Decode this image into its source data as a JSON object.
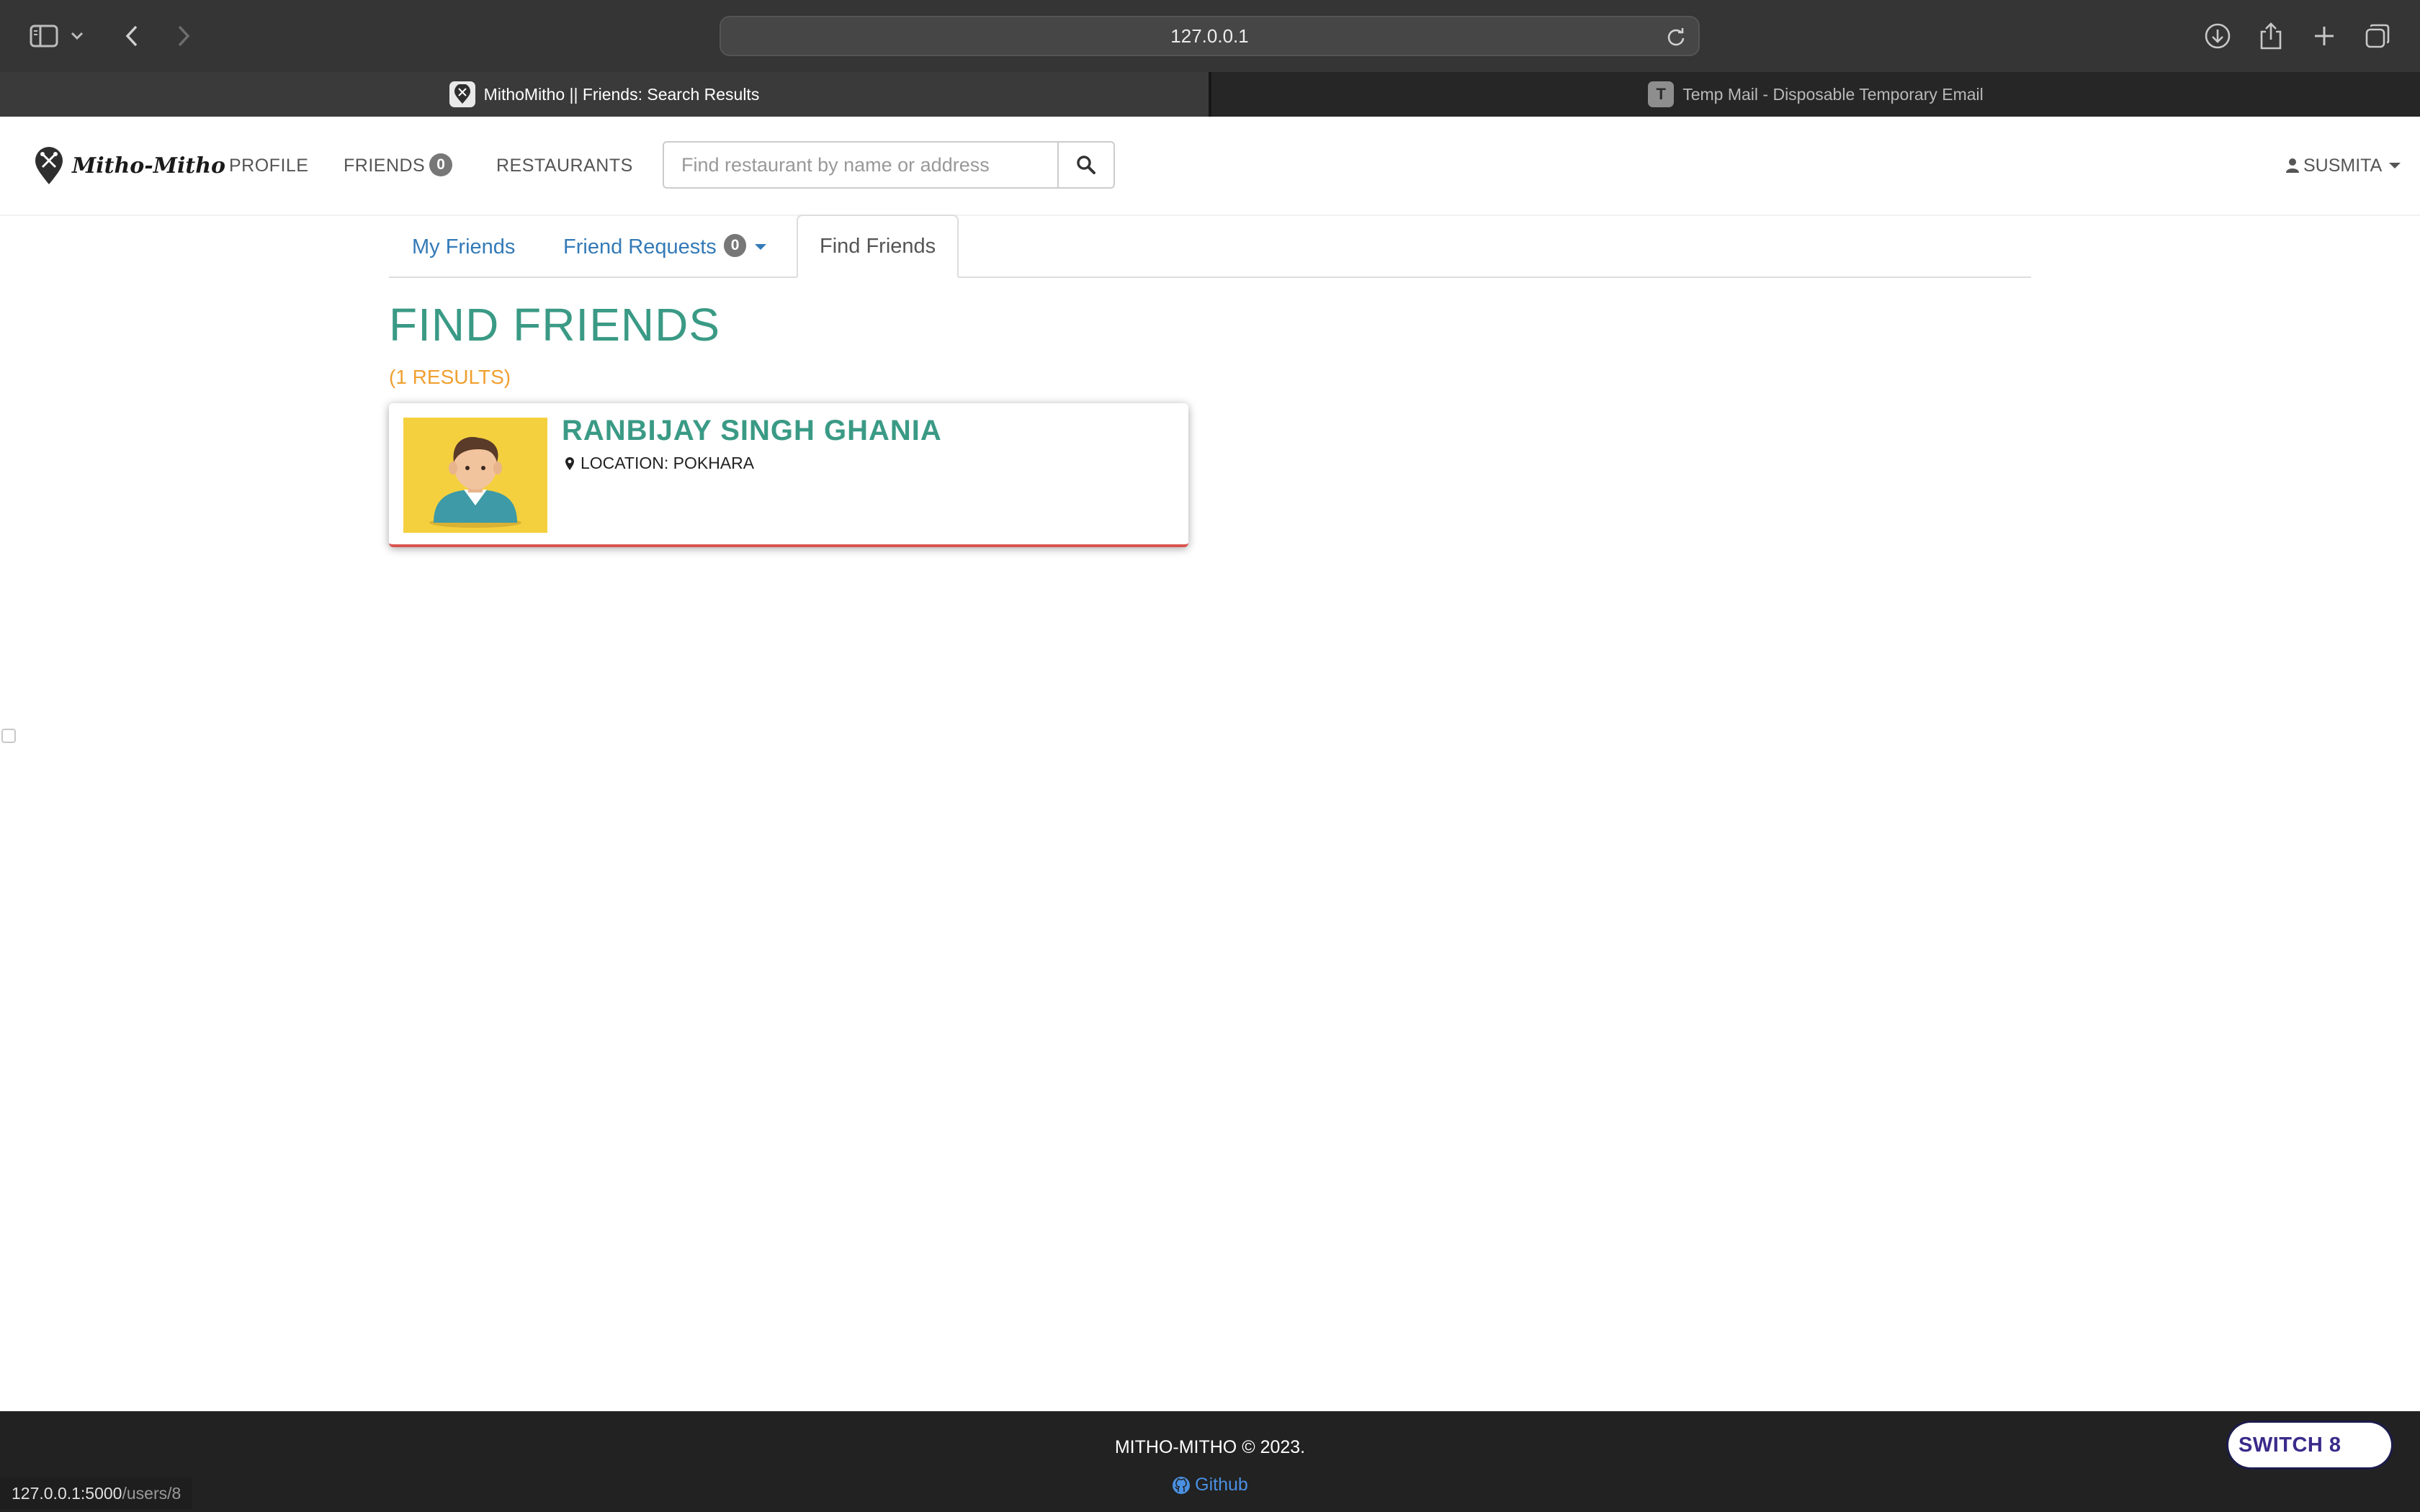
{
  "browser": {
    "url": "127.0.0.1",
    "tabs": [
      {
        "title": "MithoMitho || Friends: Search Results",
        "active": true
      },
      {
        "title": "Temp Mail - Disposable Temporary Email",
        "favicon_letter": "T",
        "active": false
      }
    ],
    "status_url_host": "127.0.0.1:5000",
    "status_url_path": "/users/8"
  },
  "nav": {
    "brand": "Mitho-Mitho",
    "profile": "PROFILE",
    "friends": "FRIENDS",
    "friends_count": "0",
    "restaurants": "RESTAURANTS",
    "search_placeholder": "Find restaurant by name or address",
    "user": "SUSMITA"
  },
  "subtabs": {
    "my_friends": "My Friends",
    "friend_requests": "Friend Requests",
    "friend_requests_count": "0",
    "find_friends": "Find Friends"
  },
  "page": {
    "title": "FIND FRIENDS",
    "results": "(1 RESULTS)"
  },
  "results": [
    {
      "name": "RANBIJAY SINGH GHANIA",
      "location": "LOCATION: POKHARA"
    }
  ],
  "footer": {
    "copyright": "MITHO-MITHO © 2023.",
    "github": "Github",
    "switch": "SWITCH 8"
  },
  "colors": {
    "accent_teal": "#3a9a85",
    "results_orange": "#f0a030",
    "link_blue": "#337ab7",
    "card_bottom_border": "#d9534f",
    "avatar_bg": "#f4d03f"
  }
}
